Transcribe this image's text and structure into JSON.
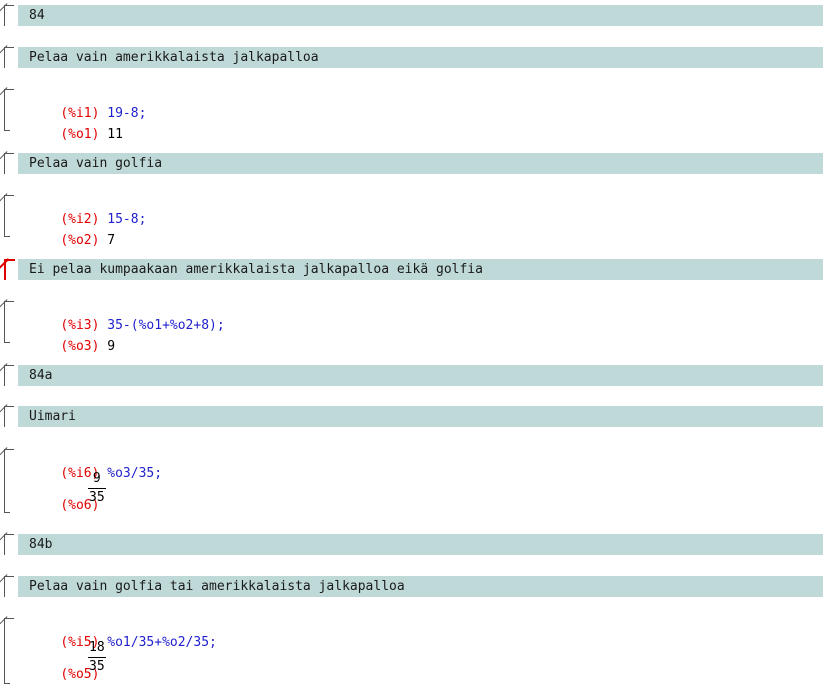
{
  "cells": {
    "t84": "84",
    "t_football": "Pelaa vain amerikkalaista jalkapalloa",
    "c1": {
      "in_label": "(%i1)",
      "input": "19-8;",
      "out_label": "(%o1)",
      "output": "11"
    },
    "t_golf": "Pelaa vain golfia",
    "c2": {
      "in_label": "(%i2)",
      "input": "15-8;",
      "out_label": "(%o2)",
      "output": "7"
    },
    "t_neither": "Ei pelaa kumpaakaan amerikkalaista jalkapalloa eikä golfia",
    "c3": {
      "in_label": "(%i3)",
      "input": "35-(%o1+%o2+8);",
      "out_label": "(%o3)",
      "output": "9"
    },
    "t84a": "84a",
    "t_swimmer": "Uimari",
    "c6": {
      "in_label": "(%i6)",
      "input": "%o3/35;",
      "out_label": "(%o6)",
      "num": "9",
      "den": "35"
    },
    "t84b": "84b",
    "t_golf_or": "Pelaa vain golfia tai amerikkalaista jalkapalloa",
    "c5": {
      "in_label": "(%i5)",
      "input": "%o1/35+%o2/35;",
      "out_label": "(%o5)",
      "num": "18",
      "den": "35"
    }
  },
  "colors": {
    "label": "#e00000",
    "input": "#1f1fcc",
    "text_cell_bg": "#bfd9d8",
    "selected_bracket": "#e00000"
  }
}
